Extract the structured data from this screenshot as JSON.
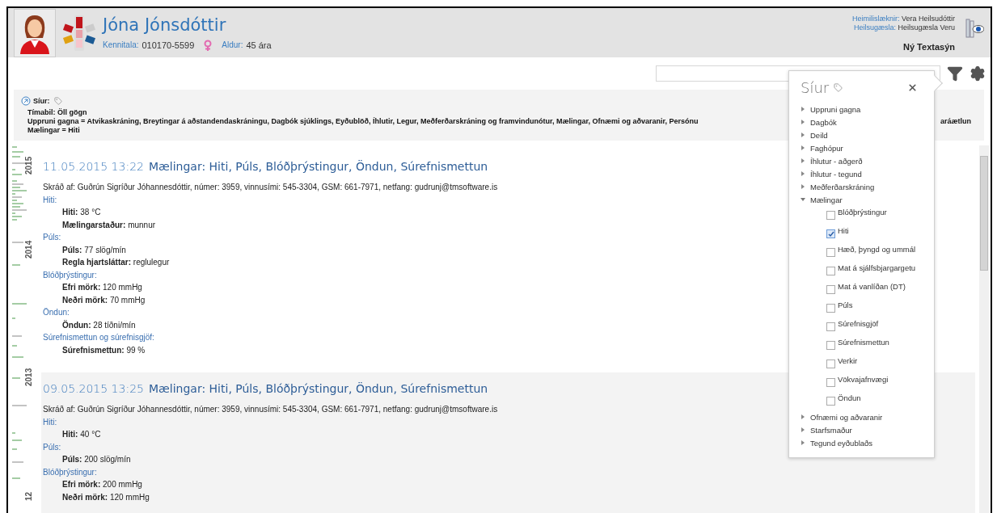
{
  "header": {
    "patient_name": "Jóna Jónsdóttir",
    "id_label": "Kennitala:",
    "id_value": "010170-5599",
    "age_label": "Aldur:",
    "age_value": "45 ára",
    "doctor_label": "Heimilislæknir:",
    "doctor_value": "Vera Heilsudóttir",
    "clinic_label": "Heilsugæsla:",
    "clinic_value": "Heilsugæsla Veru",
    "view_title": "Ný Textasýn"
  },
  "filter_summary": {
    "title": "Síur:",
    "lines": [
      {
        "text": "Tímabil: Öll gögn"
      },
      {
        "text": "Uppruni gagna = Atvikaskráning,  Breytingar á aðstandendaskráningu,  Dagbók sjúklings,  Eyðublöð,  Íhlutir,  Legur,  Meðferðarskráning og framvindunótur,  Mælingar,  Ofnæmi og aðvaranir,  Persónu",
        "tail": "aráætlun"
      },
      {
        "text": "Mælingar = Hiti"
      }
    ]
  },
  "timeline": {
    "years": [
      "2015",
      "2014",
      "2013",
      "12"
    ]
  },
  "entries": [
    {
      "date": "11.05.2015 13:22",
      "title": "Mælingar: Hiti, Púls, Blóðþrýstingur, Öndun, Súrefnismettun",
      "recorded_by": "Skráð af: Guðrún Sigríður Jóhannesdóttir, númer: 3959, vinnusími: 545-3304, GSM: 661-7971, netfang: gudrunj@tmsoftware.is",
      "groups": [
        {
          "heading": "Hiti:",
          "fields": [
            {
              "label": "Hiti:",
              "value": "38 °C"
            },
            {
              "label": "Mælingarstaður:",
              "value": "munnur"
            }
          ]
        },
        {
          "heading": "Púls:",
          "fields": [
            {
              "label": "Púls:",
              "value": "77 slög/mín"
            },
            {
              "label": "Regla hjartsláttar:",
              "value": "reglulegur"
            }
          ]
        },
        {
          "heading": "Blóðþrýstingur:",
          "fields": [
            {
              "label": "Efri mörk:",
              "value": "120 mmHg"
            },
            {
              "label": "Neðri mörk:",
              "value": "70 mmHg"
            }
          ]
        },
        {
          "heading": "Öndun:",
          "fields": [
            {
              "label": "Öndun:",
              "value": "28 tíðni/mín"
            }
          ]
        },
        {
          "heading": "Súrefnismettun og súrefnisgjöf:",
          "fields": [
            {
              "label": "Súrefnismettun:",
              "value": "99 %"
            }
          ]
        }
      ]
    },
    {
      "date": "09.05.2015 13:25",
      "title": "Mælingar: Hiti, Púls, Blóðþrýstingur, Öndun, Súrefnismettun",
      "recorded_by": "Skráð af: Guðrún Sigríður Jóhannesdóttir, númer: 3959, vinnusími: 545-3304, GSM: 661-7971, netfang: gudrunj@tmsoftware.is",
      "groups": [
        {
          "heading": "Hiti:",
          "fields": [
            {
              "label": "Hiti:",
              "value": "40 °C"
            }
          ]
        },
        {
          "heading": "Púls:",
          "fields": [
            {
              "label": "Púls:",
              "value": "200 slög/mín"
            }
          ]
        },
        {
          "heading": "Blóðþrýstingur:",
          "fields": [
            {
              "label": "Efri mörk:",
              "value": "200 mmHg"
            },
            {
              "label": "Neðri mörk:",
              "value": "120 mmHg"
            }
          ]
        }
      ]
    }
  ],
  "filter_panel": {
    "title": "Síur",
    "items": [
      {
        "label": "Uppruni gagna",
        "expanded": false
      },
      {
        "label": "Dagbók",
        "expanded": false
      },
      {
        "label": "Deild",
        "expanded": false
      },
      {
        "label": "Faghópur",
        "expanded": false
      },
      {
        "label": "Íhlutur - aðgerð",
        "expanded": false
      },
      {
        "label": "Íhlutur - tegund",
        "expanded": false
      },
      {
        "label": "Meðferðarskráning",
        "expanded": false
      },
      {
        "label": "Mælingar",
        "expanded": true,
        "children": [
          {
            "label": "Blóðþrýstingur",
            "checked": false
          },
          {
            "label": "Hiti",
            "checked": true
          },
          {
            "label": "Hæð, þyngd og ummál",
            "checked": false
          },
          {
            "label": "Mat á sjálfsbjargargetu",
            "checked": false
          },
          {
            "label": "Mat á vanlíðan (DT)",
            "checked": false
          },
          {
            "label": "Púls",
            "checked": false
          },
          {
            "label": "Súrefnisgjöf",
            "checked": false
          },
          {
            "label": "Súrefnismettun",
            "checked": false
          },
          {
            "label": "Verkir",
            "checked": false
          },
          {
            "label": "Vökvajafnvægi",
            "checked": false
          },
          {
            "label": "Öndun",
            "checked": false
          }
        ]
      },
      {
        "label": "Ofnæmi og aðvaranir",
        "expanded": false
      },
      {
        "label": "Starfsmaður",
        "expanded": false
      },
      {
        "label": "Tegund eyðublaðs",
        "expanded": false
      }
    ]
  }
}
